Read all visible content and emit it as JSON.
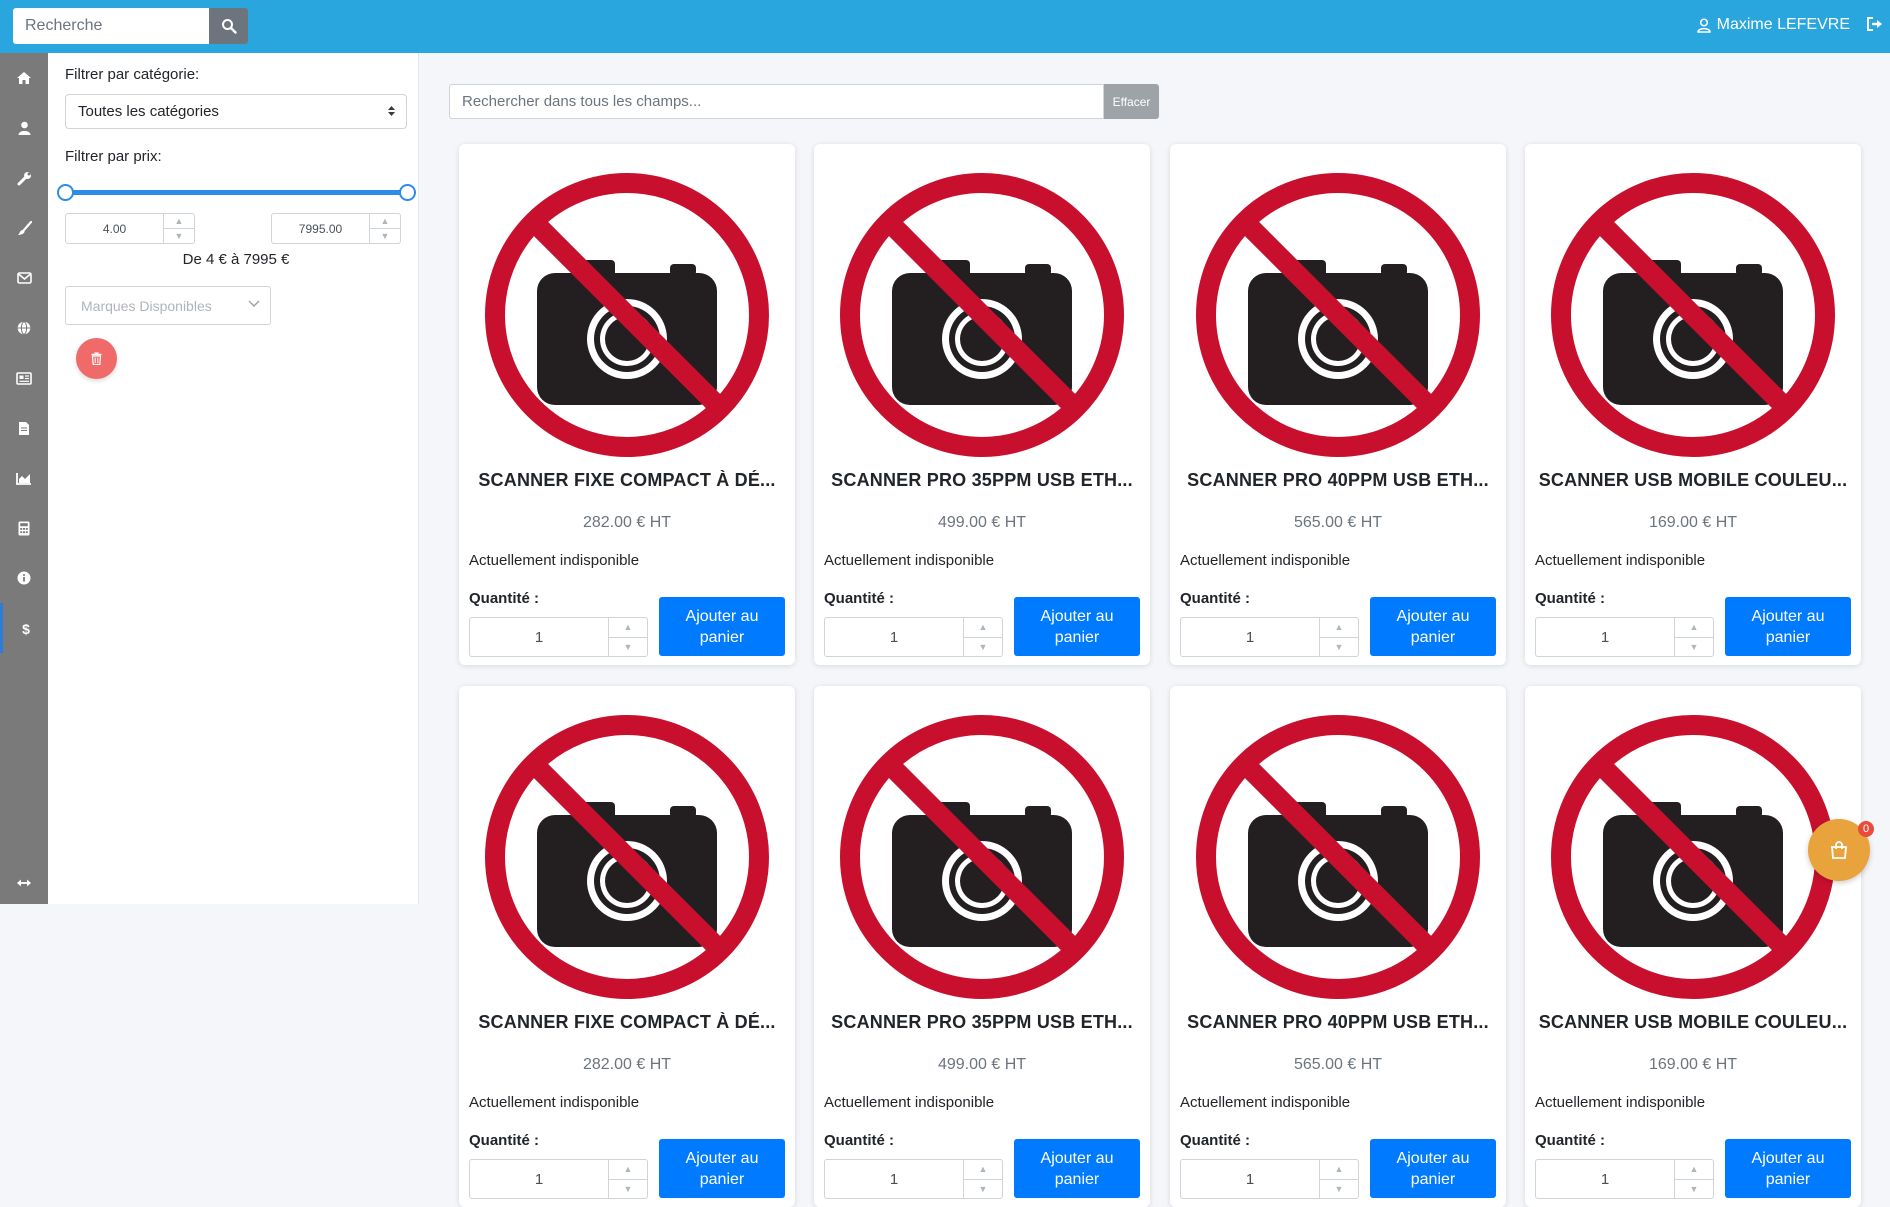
{
  "header": {
    "search_placeholder": "Recherche",
    "user_name": "Maxime LEFEVRE"
  },
  "sidebar": {
    "icons": [
      "home-icon",
      "user-icon",
      "wrench-icon",
      "brush-icon",
      "mail-icon",
      "globe-icon",
      "newspaper-icon",
      "document-icon",
      "chart-icon",
      "calculator-icon",
      "info-icon",
      "dollar-icon"
    ],
    "active_item": "dollar-icon",
    "bottom_icon": "expand-arrows-icon"
  },
  "filters": {
    "category_label": "Filtrer par catégorie:",
    "category_selected": "Toutes les catégories",
    "price_label": "Filtrer par prix:",
    "price_min": "4.00",
    "price_max": "7995.00",
    "price_range_text": "De 4 € à 7995 €",
    "brands_placeholder": "Marques Disponibles"
  },
  "main_search": {
    "placeholder": "Rechercher dans tous les champs...",
    "clear_label": "Effacer"
  },
  "products": [
    {
      "title": "SCANNER FIXE COMPACT À DÉ...",
      "price": "282.00 € HT",
      "availability": "Actuellement indisponible",
      "qty_label": "Quantité :",
      "qty": "1",
      "button": "Ajouter au panier"
    },
    {
      "title": "SCANNER PRO 35PPM USB ETH...",
      "price": "499.00 € HT",
      "availability": "Actuellement indisponible",
      "qty_label": "Quantité :",
      "qty": "1",
      "button": "Ajouter au panier"
    },
    {
      "title": "SCANNER PRO 40PPM USB ETH...",
      "price": "565.00 € HT",
      "availability": "Actuellement indisponible",
      "qty_label": "Quantité :",
      "qty": "1",
      "button": "Ajouter au panier"
    },
    {
      "title": "SCANNER USB MOBILE COULEU...",
      "price": "169.00 € HT",
      "availability": "Actuellement indisponible",
      "qty_label": "Quantité :",
      "qty": "1",
      "button": "Ajouter au panier"
    }
  ],
  "cart": {
    "count": "0"
  },
  "colors": {
    "topbar": "#29a6de",
    "primary_button": "#007bff",
    "rail": "#7a7a7a",
    "no_photo_red": "#c8102e",
    "cart_fab": "#e8a33d"
  }
}
